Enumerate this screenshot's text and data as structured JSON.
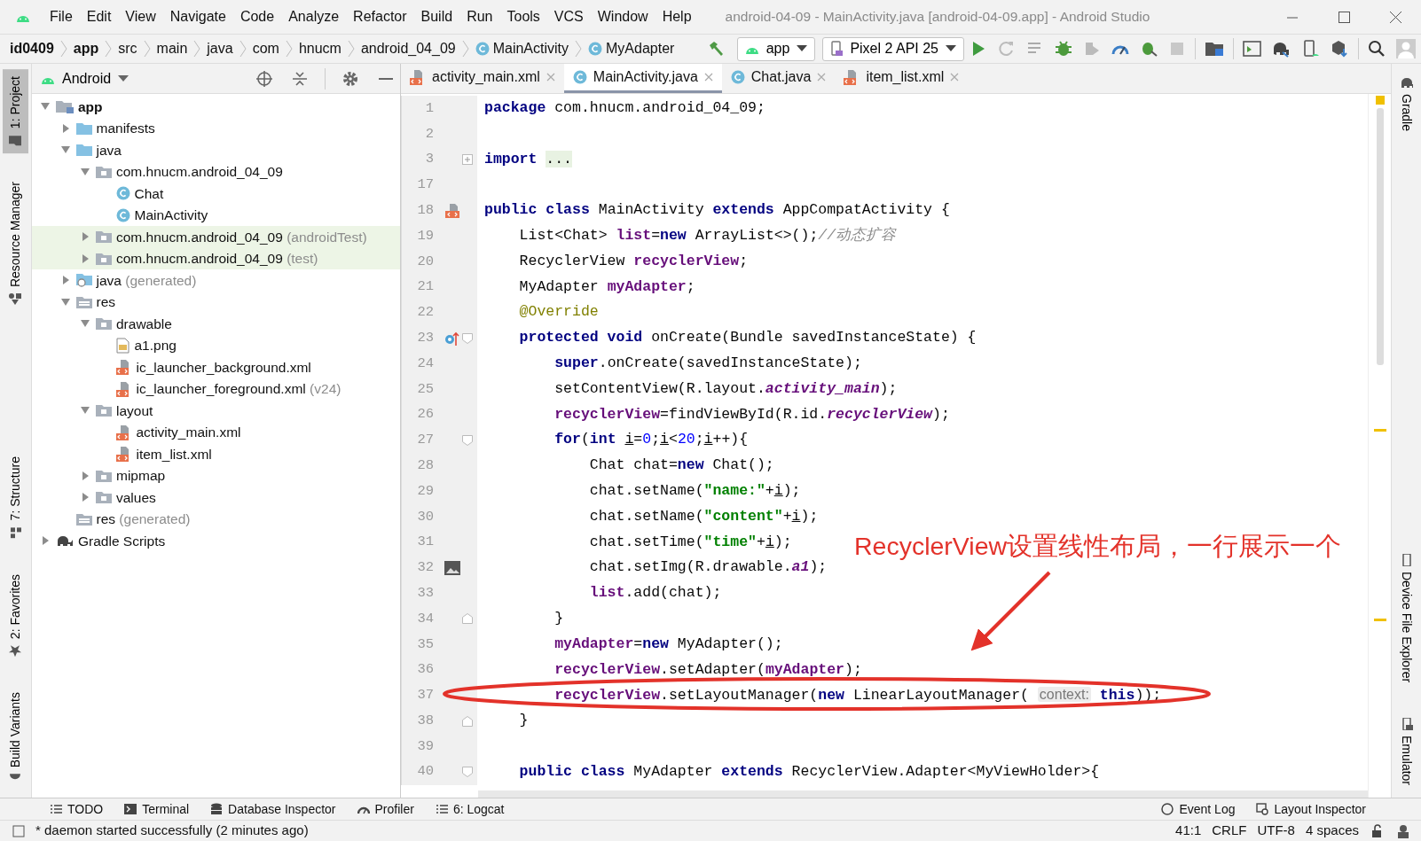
{
  "window": {
    "title": "android-04-09 - MainActivity.java [android-04-09.app] - Android Studio",
    "menu": [
      "File",
      "Edit",
      "View",
      "Navigate",
      "Code",
      "Analyze",
      "Refactor",
      "Build",
      "Run",
      "Tools",
      "VCS",
      "Window",
      "Help"
    ]
  },
  "breadcrumb": [
    {
      "label": "id0409",
      "kind": "bold"
    },
    {
      "label": "app",
      "kind": "bold"
    },
    {
      "label": "src",
      "kind": "plain"
    },
    {
      "label": "main",
      "kind": "plain"
    },
    {
      "label": "java",
      "kind": "plain"
    },
    {
      "label": "com",
      "kind": "plain"
    },
    {
      "label": "hnucm",
      "kind": "plain"
    },
    {
      "label": "android_04_09",
      "kind": "plain"
    },
    {
      "label": "MainActivity",
      "kind": "class"
    },
    {
      "label": "MyAdapter",
      "kind": "class"
    }
  ],
  "toolbar": {
    "run_config": "app",
    "device": "Pixel 2 API 25"
  },
  "left_strip": {
    "top": [
      {
        "label": "1: Project",
        "selected": true
      },
      {
        "label": "Resource Manager",
        "selected": false
      }
    ],
    "bottom": [
      {
        "label": "7: Structure",
        "selected": false
      },
      {
        "label": "2: Favorites",
        "selected": false
      },
      {
        "label": "Build Variants",
        "selected": false
      }
    ]
  },
  "right_strip": {
    "top": [
      "Gradle"
    ],
    "bottom": [
      "Device File Explorer",
      "Emulator"
    ]
  },
  "project": {
    "view": "Android",
    "tree": [
      {
        "label": "app",
        "kind": "module",
        "bold": true,
        "expanded": true,
        "children": [
          {
            "label": "manifests",
            "kind": "folder",
            "expanded": false
          },
          {
            "label": "java",
            "kind": "folder",
            "expanded": true,
            "children": [
              {
                "label": "com.hnucm.android_04_09",
                "kind": "package",
                "expanded": true,
                "highlighted": false,
                "children": [
                  {
                    "label": "Chat",
                    "kind": "class"
                  },
                  {
                    "label": "MainActivity",
                    "kind": "class"
                  }
                ]
              },
              {
                "label": "com.hnucm.android_04_09",
                "note": "(androidTest)",
                "kind": "package",
                "expanded": false,
                "highlighted": true
              },
              {
                "label": "com.hnucm.android_04_09",
                "note": "(test)",
                "kind": "package",
                "expanded": false,
                "highlighted": true
              }
            ]
          },
          {
            "label": "java",
            "note": "(generated)",
            "kind": "genfolder",
            "expanded": false
          },
          {
            "label": "res",
            "kind": "resfolder",
            "expanded": true,
            "children": [
              {
                "label": "drawable",
                "kind": "package",
                "expanded": true,
                "children": [
                  {
                    "label": "a1.png",
                    "kind": "image"
                  },
                  {
                    "label": "ic_launcher_background.xml",
                    "kind": "xml"
                  },
                  {
                    "label": "ic_launcher_foreground.xml",
                    "note": "(v24)",
                    "kind": "xml"
                  }
                ]
              },
              {
                "label": "layout",
                "kind": "package",
                "expanded": true,
                "children": [
                  {
                    "label": "activity_main.xml",
                    "kind": "xml"
                  },
                  {
                    "label": "item_list.xml",
                    "kind": "xml"
                  }
                ]
              },
              {
                "label": "mipmap",
                "kind": "package",
                "expanded": false
              },
              {
                "label": "values",
                "kind": "package",
                "expanded": false
              }
            ]
          },
          {
            "label": "res",
            "note": "(generated)",
            "kind": "resfolder"
          }
        ]
      },
      {
        "label": "Gradle Scripts",
        "kind": "gradle",
        "expanded": false
      }
    ]
  },
  "tabs": [
    {
      "label": "activity_main.xml",
      "kind": "xml",
      "selected": false
    },
    {
      "label": "MainActivity.java",
      "kind": "class",
      "selected": true
    },
    {
      "label": "Chat.java",
      "kind": "class",
      "selected": false
    },
    {
      "label": "item_list.xml",
      "kind": "xml",
      "selected": false
    }
  ],
  "code": [
    {
      "number": "1",
      "tokens": [
        {
          "kind": "kw",
          "text": "package"
        },
        {
          "kind": "p",
          "text": " com.hnucm.android_04_09;"
        }
      ]
    },
    {
      "number": "2"
    },
    {
      "number": "3",
      "tokens": [
        {
          "kind": "kw",
          "text": "import "
        },
        {
          "kind": "folded",
          "text": "..."
        }
      ]
    },
    {
      "number": "17"
    },
    {
      "number": "18",
      "tokens": [
        {
          "kind": "kw",
          "text": "public class"
        },
        {
          "kind": "p",
          "text": " MainActivity "
        },
        {
          "kind": "kw",
          "text": "extends"
        },
        {
          "kind": "p",
          "text": " AppCompatActivity {"
        }
      ]
    },
    {
      "number": "19",
      "tokens": [
        {
          "kind": "p",
          "text": "    List<Chat> "
        },
        {
          "kind": "f",
          "text": "list"
        },
        {
          "kind": "p",
          "text": "="
        },
        {
          "kind": "kw",
          "text": "new"
        },
        {
          "kind": "p",
          "text": " ArrayList<>();"
        },
        {
          "kind": "c",
          "text": "//动态扩容"
        }
      ]
    },
    {
      "number": "20",
      "tokens": [
        {
          "kind": "p",
          "text": "    RecyclerView "
        },
        {
          "kind": "f",
          "text": "recyclerView"
        },
        {
          "kind": "p",
          "text": ";"
        }
      ]
    },
    {
      "number": "21",
      "tokens": [
        {
          "kind": "p",
          "text": "    MyAdapter "
        },
        {
          "kind": "f",
          "text": "myAdapter"
        },
        {
          "kind": "p",
          "text": ";"
        }
      ]
    },
    {
      "number": "22",
      "tokens": [
        {
          "kind": "a",
          "text": "    @Override"
        }
      ]
    },
    {
      "number": "23",
      "tokens": [
        {
          "kind": "kw",
          "text": "    protected void"
        },
        {
          "kind": "p",
          "text": " onCreate(Bundle savedInstanceState) {"
        }
      ]
    },
    {
      "number": "24",
      "tokens": [
        {
          "kind": "kw",
          "text": "        super"
        },
        {
          "kind": "p",
          "text": ".onCreate(savedInstanceState);"
        }
      ]
    },
    {
      "number": "25",
      "tokens": [
        {
          "kind": "p",
          "text": "        setContentView(R.layout."
        },
        {
          "kind": "fi",
          "text": "activity_main"
        },
        {
          "kind": "p",
          "text": ");"
        }
      ]
    },
    {
      "number": "26",
      "tokens": [
        {
          "kind": "f",
          "text": "        recyclerView"
        },
        {
          "kind": "p",
          "text": "=findViewById(R.id."
        },
        {
          "kind": "fi",
          "text": "recyclerView"
        },
        {
          "kind": "p",
          "text": ");"
        }
      ]
    },
    {
      "number": "27",
      "tokens": [
        {
          "kind": "kw",
          "text": "        for"
        },
        {
          "kind": "p",
          "text": "("
        },
        {
          "kind": "kw",
          "text": "int "
        },
        {
          "kind": "u",
          "text": "i"
        },
        {
          "kind": "p",
          "text": "="
        },
        {
          "kind": "n",
          "text": "0"
        },
        {
          "kind": "p",
          "text": ";"
        },
        {
          "kind": "u",
          "text": "i"
        },
        {
          "kind": "p",
          "text": "<"
        },
        {
          "kind": "n",
          "text": "20"
        },
        {
          "kind": "p",
          "text": ";"
        },
        {
          "kind": "u",
          "text": "i"
        },
        {
          "kind": "p",
          "text": "++){"
        }
      ]
    },
    {
      "number": "28",
      "tokens": [
        {
          "kind": "p",
          "text": "            Chat chat="
        },
        {
          "kind": "kw",
          "text": "new"
        },
        {
          "kind": "p",
          "text": " Chat();"
        }
      ]
    },
    {
      "number": "29",
      "tokens": [
        {
          "kind": "p",
          "text": "            chat.setName("
        },
        {
          "kind": "s",
          "text": "\"name:\""
        },
        {
          "kind": "p",
          "text": "+"
        },
        {
          "kind": "u",
          "text": "i"
        },
        {
          "kind": "p",
          "text": ");"
        }
      ]
    },
    {
      "number": "30",
      "tokens": [
        {
          "kind": "p",
          "text": "            chat.setName("
        },
        {
          "kind": "s",
          "text": "\"content\""
        },
        {
          "kind": "p",
          "text": "+"
        },
        {
          "kind": "u",
          "text": "i"
        },
        {
          "kind": "p",
          "text": ");"
        }
      ]
    },
    {
      "number": "31",
      "tokens": [
        {
          "kind": "p",
          "text": "            chat.setTime("
        },
        {
          "kind": "s",
          "text": "\"time\""
        },
        {
          "kind": "p",
          "text": "+"
        },
        {
          "kind": "u",
          "text": "i"
        },
        {
          "kind": "p",
          "text": ");"
        }
      ]
    },
    {
      "number": "32",
      "tokens": [
        {
          "kind": "p",
          "text": "            chat.setImg(R.drawable."
        },
        {
          "kind": "fi",
          "text": "a1"
        },
        {
          "kind": "p",
          "text": ");"
        }
      ]
    },
    {
      "number": "33",
      "tokens": [
        {
          "kind": "f",
          "text": "            list"
        },
        {
          "kind": "p",
          "text": ".add(chat);"
        }
      ]
    },
    {
      "number": "34",
      "tokens": [
        {
          "kind": "p",
          "text": "        }"
        }
      ]
    },
    {
      "number": "35",
      "tokens": [
        {
          "kind": "f",
          "text": "        myAdapter"
        },
        {
          "kind": "p",
          "text": "="
        },
        {
          "kind": "kw",
          "text": "new"
        },
        {
          "kind": "p",
          "text": " MyAdapter();"
        }
      ]
    },
    {
      "number": "36",
      "tokens": [
        {
          "kind": "f",
          "text": "        recyclerView"
        },
        {
          "kind": "p",
          "text": ".setAdapter("
        },
        {
          "kind": "f",
          "text": "myAdapter"
        },
        {
          "kind": "p",
          "text": ");"
        }
      ]
    },
    {
      "number": "37",
      "tokens": [
        {
          "kind": "f",
          "text": "        recyclerView"
        },
        {
          "kind": "p",
          "text": ".setLayoutManager("
        },
        {
          "kind": "kw",
          "text": "new"
        },
        {
          "kind": "p",
          "text": " LinearLayoutManager( "
        },
        {
          "kind": "h",
          "text": "context:"
        },
        {
          "kind": "kw",
          "text": " this"
        },
        {
          "kind": "p",
          "text": "));"
        }
      ]
    },
    {
      "number": "38",
      "tokens": [
        {
          "kind": "p",
          "text": "    }"
        }
      ]
    },
    {
      "number": "39"
    },
    {
      "number": "40",
      "tokens": [
        {
          "kind": "kw",
          "text": "    public class"
        },
        {
          "kind": "p",
          "text": " MyAdapter "
        },
        {
          "kind": "kw",
          "text": "extends"
        },
        {
          "kind": "p",
          "text": " RecyclerView.Adapter<MyViewHolder>{"
        }
      ]
    }
  ],
  "annotation": {
    "text": "RecyclerView设置线性布局，一行展示一个"
  },
  "bottom_tools": {
    "left": [
      "TODO",
      "Terminal",
      "Database Inspector",
      "Profiler",
      "6: Logcat"
    ],
    "right": [
      "Event Log",
      "Layout Inspector"
    ]
  },
  "status_bar": {
    "message": "* daemon started successfully (2 minutes ago)",
    "items": [
      "41:1",
      "CRLF",
      "UTF-8",
      "4 spaces"
    ]
  }
}
